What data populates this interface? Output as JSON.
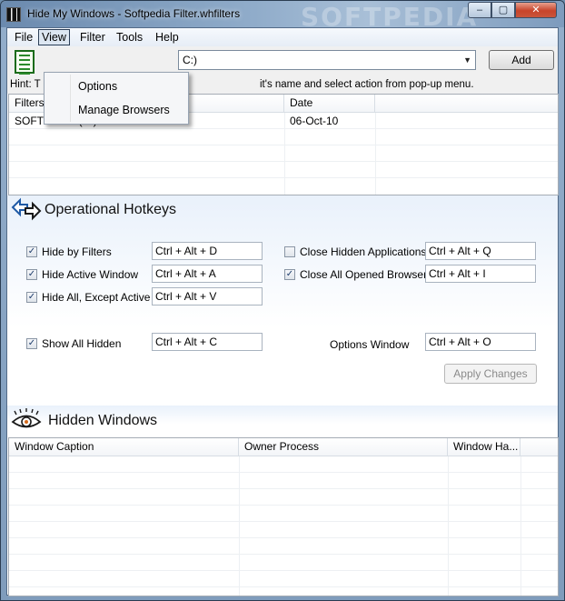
{
  "window": {
    "title": "Hide My Windows - Softpedia Filter.whfilters",
    "watermark": "SOFTPEDIA",
    "controls": {
      "minimize": "–",
      "maximize": "▢",
      "close": "✕"
    }
  },
  "menubar": {
    "file": "File",
    "view": "View",
    "filter": "Filter",
    "tools": "Tools",
    "help": "Help"
  },
  "view_menu": {
    "items": [
      "Options",
      "Manage Browsers"
    ]
  },
  "toolbar": {
    "combo_value": "C:)",
    "add_button": "Add",
    "hint_prefix": "Hint: T",
    "hint_suffix": "it's name and select action from pop-up menu."
  },
  "filters_table": {
    "columns": [
      "Filters",
      "Date"
    ],
    "rows": [
      {
        "filter": "SOFTPEDIA (C:)",
        "date": "06-Oct-10"
      }
    ]
  },
  "hotkeys": {
    "title": "Operational Hotkeys",
    "items": [
      {
        "label": "Hide by Filters",
        "checked": true,
        "value": "Ctrl + Alt + D"
      },
      {
        "label": "Hide Active Window",
        "checked": true,
        "value": "Ctrl + Alt + A"
      },
      {
        "label": "Hide All, Except Active",
        "checked": true,
        "value": "Ctrl + Alt + V"
      },
      {
        "label": "Show All Hidden",
        "checked": true,
        "value": "Ctrl + Alt + C"
      },
      {
        "label": "Close Hidden Applications",
        "checked": false,
        "value": "Ctrl + Alt + Q"
      },
      {
        "label": "Close All Opened Browsers",
        "checked": true,
        "value": "Ctrl + Alt + I"
      },
      {
        "label": "Options Window",
        "value": "Ctrl + Alt + O"
      }
    ],
    "apply_button": "Apply Changes"
  },
  "hidden_windows": {
    "title": "Hidden Windows",
    "columns": [
      "Window Caption",
      "Owner Process",
      "Window Ha..."
    ]
  },
  "icons": {
    "document": "document-list-icon",
    "hotkeys": "hotkey-arrows-icon",
    "hidden": "eye-icon",
    "check": "✓"
  },
  "colors": {
    "accent": "#1f5aa6",
    "frame": "#8aa6c4",
    "disabled_text": "#8a8a8a"
  }
}
